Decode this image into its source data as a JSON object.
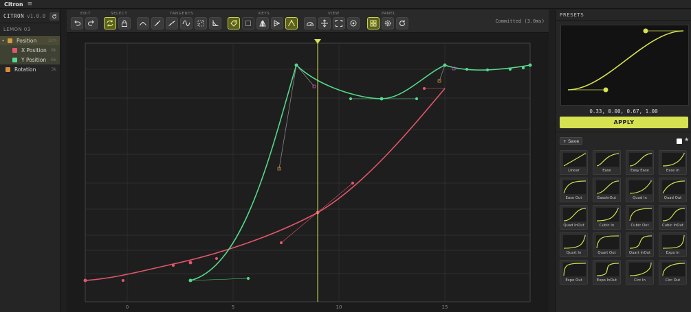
{
  "app": {
    "name": "Citron",
    "menu_glyph": "≡"
  },
  "sidebar": {
    "brand": "CITRON",
    "version": "v1.0.0",
    "layer": "LEMON 03",
    "tracks": [
      {
        "label": "Position",
        "count": "2ch",
        "color": "#d59a3c",
        "expanded": true
      },
      {
        "label": "X Position",
        "count": "8k",
        "color": "#e2566c"
      },
      {
        "label": "Y Position",
        "count": "6k",
        "color": "#55d98a"
      },
      {
        "label": "Rotation",
        "count": "3k",
        "color": "#d98a3c"
      }
    ]
  },
  "toolbar": {
    "groups": [
      "EDIT",
      "SELECT",
      "TANGENTS",
      "KEYS",
      "VIEW",
      "PANEL"
    ],
    "status": "Committed (3.0ms)",
    "buttons": [
      {
        "icon": "undo-icon",
        "active": false
      },
      {
        "icon": "redo-icon",
        "active": false
      },
      {
        "icon": "select-loop-icon",
        "active": true
      },
      {
        "icon": "lock-icon",
        "active": false
      },
      {
        "icon": "tangent-auto-icon",
        "active": false
      },
      {
        "icon": "tangent-linear-icon",
        "active": false
      },
      {
        "icon": "tangent-step-icon",
        "active": false
      },
      {
        "icon": "tangent-smooth-icon",
        "active": false
      },
      {
        "icon": "tangent-broken-icon",
        "active": false
      },
      {
        "icon": "tangent-corner-icon",
        "active": false
      },
      {
        "icon": "key-tag-icon",
        "active": true
      },
      {
        "icon": "key-frame-icon",
        "active": false
      },
      {
        "icon": "flip-icon",
        "active": false
      },
      {
        "icon": "mirror-icon",
        "active": false
      },
      {
        "icon": "key-node-icon",
        "active": true
      },
      {
        "icon": "speed-icon",
        "active": false
      },
      {
        "icon": "fit-icon",
        "active": false
      },
      {
        "icon": "frame-all-icon",
        "active": false
      },
      {
        "icon": "target-icon",
        "active": false
      },
      {
        "icon": "grid-icon",
        "active": true
      },
      {
        "icon": "settings-icon",
        "active": false
      },
      {
        "icon": "refresh-icon",
        "active": false
      }
    ]
  },
  "graph": {
    "x_ticks": [
      "0",
      "5",
      "10",
      "15"
    ],
    "playhead_frame": 9,
    "curves": [
      {
        "name": "X Position",
        "color": "#e2566c"
      },
      {
        "name": "Y Position",
        "color": "#55d98a"
      }
    ],
    "handle_color": "#e0902a",
    "handle_color_alt": "#c04ab0"
  },
  "presets": {
    "title": "PRESETS",
    "bezier": "0.33, 0.00, 0.67, 1.00",
    "apply_label": "APPLY",
    "save_label": "+ Save",
    "star_glyph": "★",
    "items": [
      "Linear",
      "Ease",
      "Easy Ease",
      "Ease In",
      "Ease Out",
      "EaseInOut",
      "Quad In",
      "Quad Out",
      "Quad InOut",
      "Cubic In",
      "Cubic Out",
      "Cubic InOut",
      "Quart In",
      "Quart Out",
      "Quart InOut",
      "Expo In",
      "Expo Out",
      "Expo InOut",
      "Circ In",
      "Circ Out"
    ]
  },
  "colors": {
    "accent": "#d6e250",
    "bg": "#1b1b1b"
  }
}
